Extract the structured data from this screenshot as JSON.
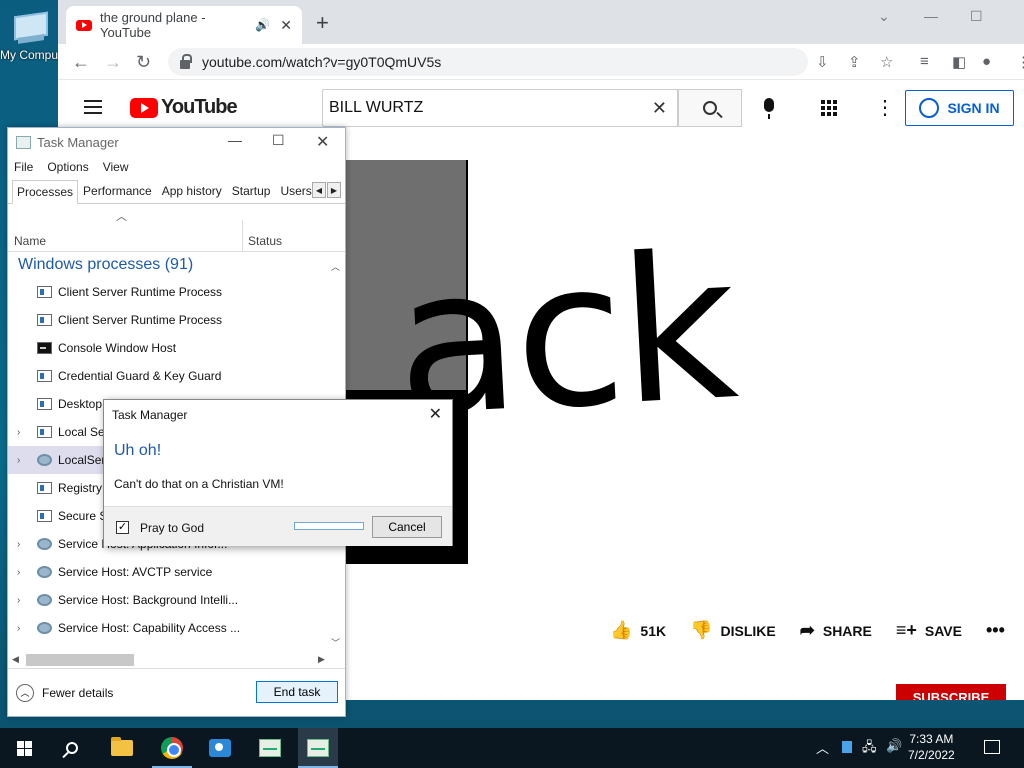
{
  "desktop": {
    "icon_label": "My Comput"
  },
  "chrome": {
    "tab_title": "the ground plane - YouTube",
    "url": "youtube.com/watch?v=gy0T0QmUV5s"
  },
  "youtube": {
    "logo_text": "YouTube",
    "search_value": "BILL WURTZ",
    "signin_label": "SIGN IN",
    "video_word": "ack",
    "actions": {
      "like_count": "51K",
      "dislike_label": "DISLIKE",
      "share_label": "SHARE",
      "save_label": "SAVE"
    },
    "subscribe_label": "SUBSCRIBE"
  },
  "task_manager": {
    "title": "Task Manager",
    "menu": [
      "File",
      "Options",
      "View"
    ],
    "tabs": [
      "Processes",
      "Performance",
      "App history",
      "Startup",
      "Users"
    ],
    "col_name": "Name",
    "col_status": "Status",
    "group": "Windows processes (91)",
    "rows": [
      {
        "name": "Client Server Runtime Process"
      },
      {
        "name": "Client Server Runtime Process"
      },
      {
        "name": "Console Window Host"
      },
      {
        "name": "Credential Guard & Key Guard"
      },
      {
        "name": "Desktop"
      },
      {
        "name": "Local Se"
      },
      {
        "name": "LocalSer"
      },
      {
        "name": "Registry"
      },
      {
        "name": "Secure S"
      },
      {
        "name": "Service Host: Application Infor..."
      },
      {
        "name": "Service Host: AVCTP service"
      },
      {
        "name": "Service Host: Background Intelli..."
      },
      {
        "name": "Service Host: Capability Access ..."
      }
    ],
    "fewer_details": "Fewer details",
    "end_task": "End task"
  },
  "dialog": {
    "title": "Task Manager",
    "heading": "Uh oh!",
    "message": "Can't do that on a Christian VM!",
    "checkbox_label": "Pray to God",
    "checkbox_checked": true,
    "progress": 0.0,
    "cancel_label": "Cancel"
  },
  "taskbar": {
    "time": "7:33 AM",
    "date": "7/2/2022"
  }
}
